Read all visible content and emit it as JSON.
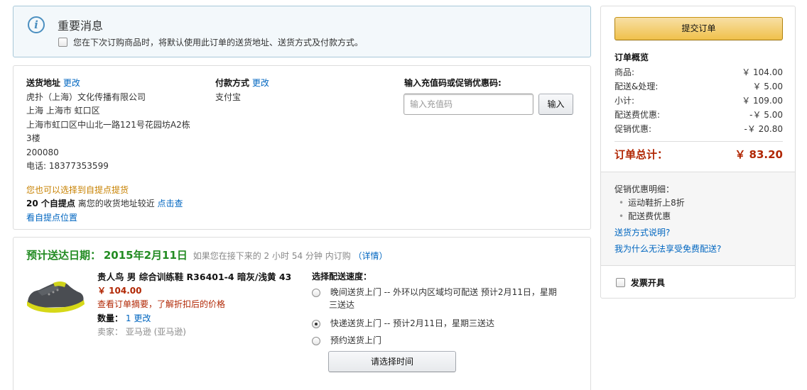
{
  "notice": {
    "title": "重要消息",
    "checkbox_text": "您在下次订购商品时，将默认使用此订单的送货地址、送货方式及付款方式。"
  },
  "address": {
    "label": "送货地址",
    "change": "更改",
    "lines": [
      "虎扑（上海）文化传播有限公司",
      "上海 上海市 虹口区",
      "上海市虹口区中山北一路121号花园坊A2栋",
      "3楼",
      "200080",
      "电话: 18377353599"
    ],
    "pickup_hint": "您也可以选择到自提点提货",
    "pickup_count": "20 个自提点",
    "pickup_text": " 离您的收货地址较近 ",
    "pickup_link1": "点击查",
    "pickup_link2": "看自提点位置"
  },
  "payment": {
    "label": "付款方式",
    "change": "更改",
    "method": "支付宝"
  },
  "coupon": {
    "label": "输入充值码或促销优惠码:",
    "placeholder": "输入充值码",
    "button": "输入"
  },
  "delivery": {
    "date_label": "预计送达日期：",
    "date": "2015年2月11日",
    "countdown": "如果您在接下来的 2 小时 54 分钟 内订购",
    "details": "（详情）",
    "product": {
      "title": "贵人鸟 男 综合训练鞋 R36401-4 暗灰/浅黄 43",
      "price": "￥ 104.00",
      "discount_note": "查看订单摘要，了解折扣后的价格",
      "qty_label": "数量：",
      "qty": "1",
      "qty_change": "更改",
      "seller": "卖家：  亚马逊 (亚马逊)"
    },
    "speed_title": "选择配送速度：",
    "options": [
      {
        "label": "晚间送货上门 -- 外环以内区域均可配送  预计2月11日，星期",
        "label2": "三送达",
        "selected": false
      },
      {
        "label": "快递送货上门 --    预计2月11日，星期三送达",
        "selected": true
      },
      {
        "label": "预约送货上门",
        "selected": false
      }
    ],
    "time_button": "请选择时间"
  },
  "summary": {
    "submit": "提交订单",
    "title": "订单概览",
    "rows": [
      {
        "label": "商品:",
        "value": "￥ 104.00"
      },
      {
        "label": "配送&处理:",
        "value": "￥ 5.00"
      },
      {
        "label": "小计:",
        "value": "￥ 109.00"
      },
      {
        "label": "配送费优惠:",
        "value": "-￥ 5.00"
      },
      {
        "label": "促销优惠:",
        "value": "-￥ 20.80"
      }
    ],
    "total_label": "订单总计：",
    "total_value": "￥ 83.20",
    "promo_title": "促销优惠明细：",
    "promos": [
      "运动鞋折上8折",
      "配送费优惠"
    ],
    "link1": "送货方式说明?",
    "link2": "我为什么无法享受免费配送?",
    "invoice": "发票开具"
  },
  "colors": {
    "link": "#0066c0",
    "price_red": "#b12704",
    "date_green": "#228b22",
    "pickup_orange": "#c78100"
  }
}
